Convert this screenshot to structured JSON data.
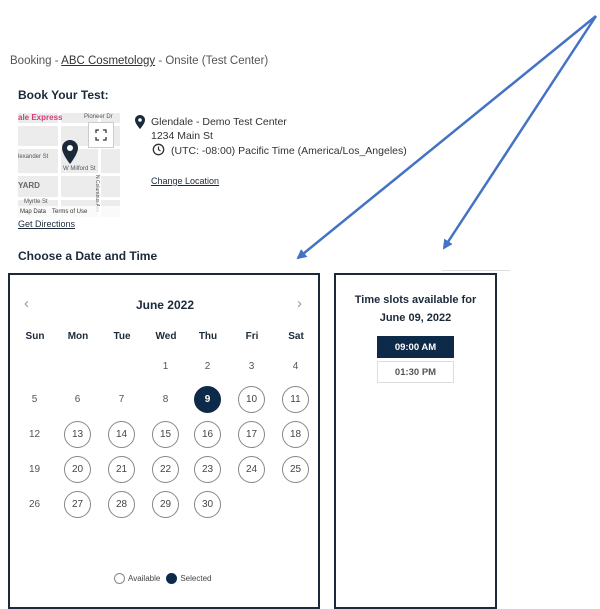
{
  "breadcrumb": {
    "prefix": "Booking - ",
    "link": "ABC Cosmetology",
    "suffix": " - Onsite (Test Center)"
  },
  "book_heading": "Book Your Test:",
  "map": {
    "labels": [
      "ale Express",
      "Pioneer Dr",
      "lexander St",
      "W Milford St",
      "YARD",
      "Myrtle St",
      "N Columbus Ave"
    ],
    "map_data": "Map Data",
    "terms": "Terms of Use"
  },
  "get_directions": "Get Directions",
  "location": {
    "name": "Glendale - Demo Test Center",
    "address": "1234 Main St",
    "timezone": "(UTC: -08:00) Pacific Time (America/Los_Angeles)",
    "change": "Change Location"
  },
  "choose_heading": "Choose a Date and Time",
  "calendar": {
    "month": "June 2022",
    "prev": "‹",
    "next": "›",
    "weekdays": [
      "Sun",
      "Mon",
      "Tue",
      "Wed",
      "Thu",
      "Fri",
      "Sat"
    ],
    "first_weekday": 3,
    "days_in_month": 30,
    "selected": 9,
    "available": [
      10,
      11,
      13,
      14,
      15,
      16,
      17,
      18,
      20,
      21,
      22,
      23,
      24,
      25,
      27,
      28,
      29,
      30
    ],
    "legend_available": "Available",
    "legend_selected": "Selected"
  },
  "timeslots": {
    "title_line1": "Time slots available for",
    "title_line2": "June 09, 2022",
    "slots": [
      "09:00 AM",
      "01:30 PM"
    ],
    "selected_index": 0
  },
  "colors": {
    "selected": "#0d2a49",
    "arrow": "#4472c4",
    "border": "#1b2a3a"
  }
}
